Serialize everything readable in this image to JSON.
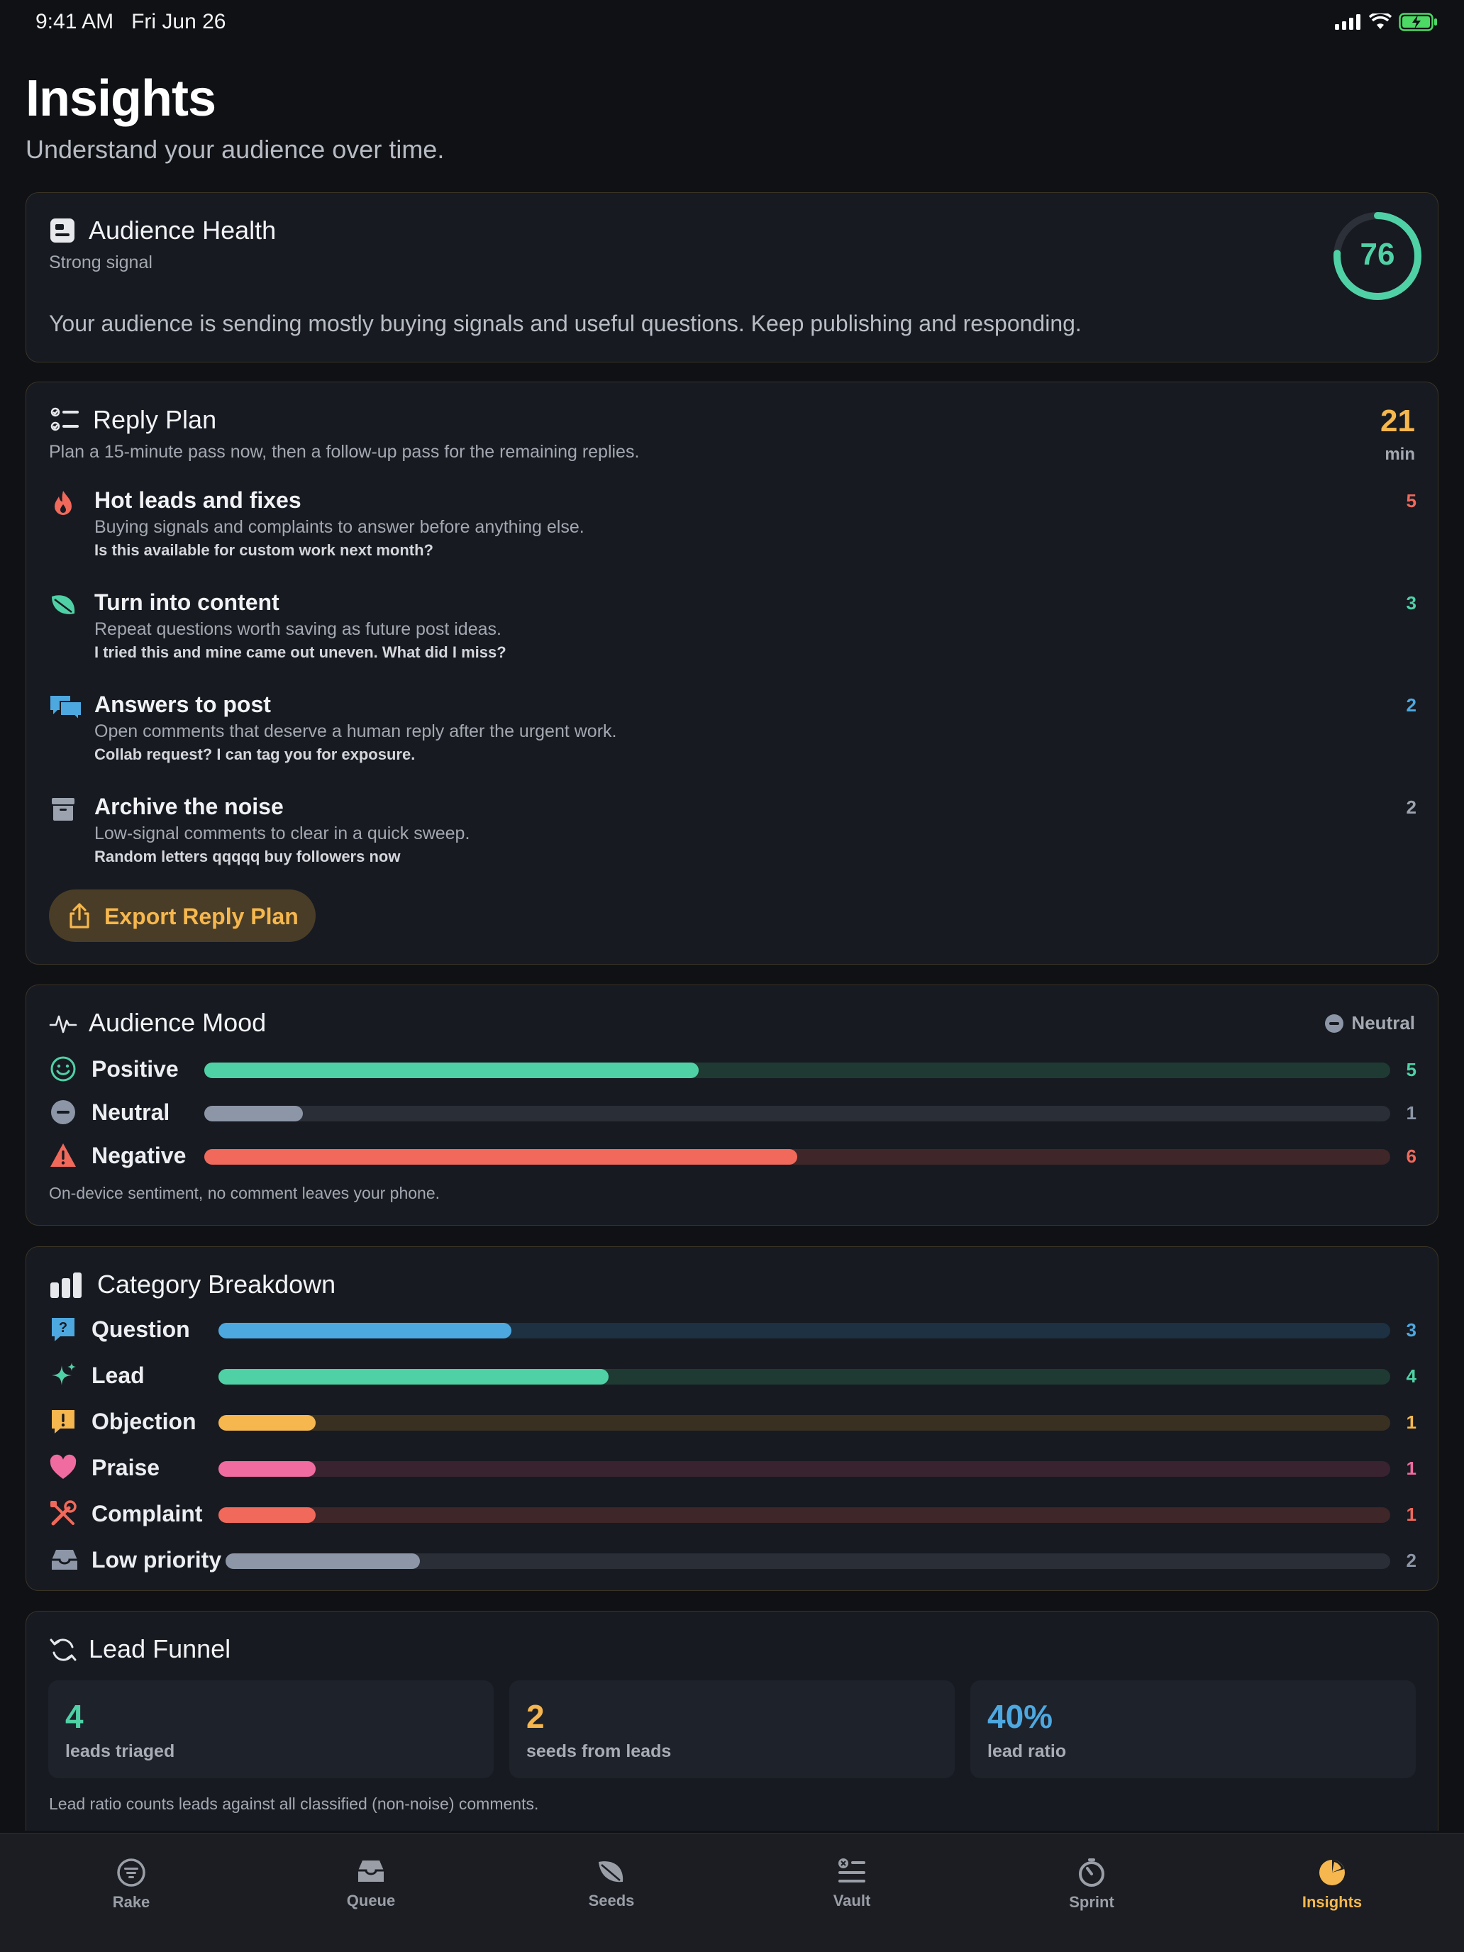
{
  "status_bar": {
    "time": "9:41 AM",
    "date": "Fri Jun 26",
    "icons": [
      "signal-icon",
      "wifi-icon",
      "battery-charging-icon"
    ]
  },
  "page": {
    "title": "Insights",
    "subtitle": "Understand your audience over time."
  },
  "audience_health": {
    "title": "Audience Health",
    "status": "Strong signal",
    "score": "76",
    "score_fraction": 0.76,
    "description": "Your audience is sending mostly buying signals and useful questions. Keep publishing and responding.",
    "icon": "id-card-icon"
  },
  "reply_plan": {
    "title": "Reply Plan",
    "description": "Plan a 15-minute pass now, then a follow-up pass for the remaining replies.",
    "minutes": "21",
    "minutes_unit": "min",
    "items": [
      {
        "title": "Hot leads and fixes",
        "desc": "Buying signals and complaints to answer before anything else.",
        "example": "Is this available for custom work next month?",
        "count": "5",
        "color": "#f0695b",
        "icon": "flame-icon"
      },
      {
        "title": "Turn into content",
        "desc": "Repeat questions worth saving as future post ideas.",
        "example": "I tried this and mine came out uneven. What did I miss?",
        "count": "3",
        "color": "#4fd1a5",
        "icon": "leaf-icon"
      },
      {
        "title": "Answers to post",
        "desc": "Open comments that deserve a human reply after the urgent work.",
        "example": "Collab request? I can tag you for exposure.",
        "count": "2",
        "color": "#4ea8e0",
        "icon": "chat-bubbles-icon"
      },
      {
        "title": "Archive the noise",
        "desc": "Low-signal comments to clear in a quick sweep.",
        "example": "Random letters qqqqq buy followers now",
        "count": "2",
        "color": "#9ca3af",
        "icon": "archive-box-icon"
      }
    ],
    "export_label": "Export Reply Plan"
  },
  "audience_mood": {
    "title": "Audience Mood",
    "overall": "Neutral",
    "footnote": "On-device sentiment, no comment leaves your phone.",
    "rows": [
      {
        "label": "Positive",
        "count": "5",
        "fraction": 0.417,
        "color": "#4fd1a5",
        "track": "#1f3a33",
        "icon": "smile-icon"
      },
      {
        "label": "Neutral",
        "count": "1",
        "fraction": 0.083,
        "color": "#8c96a6",
        "track": "#2a2e37",
        "icon": "minus-circle-icon"
      },
      {
        "label": "Negative",
        "count": "6",
        "fraction": 0.5,
        "color": "#f0695b",
        "track": "#3e2629",
        "icon": "warning-triangle-icon"
      }
    ]
  },
  "category_breakdown": {
    "title": "Category Breakdown",
    "rows": [
      {
        "label": "Question",
        "count": "3",
        "fraction": 0.25,
        "color": "#4ea8e0",
        "track": "#1d3142",
        "icon": "question-bubble-icon"
      },
      {
        "label": "Lead",
        "count": "4",
        "fraction": 0.333,
        "color": "#4fd1a5",
        "track": "#1f3a33",
        "icon": "sparkle-icon"
      },
      {
        "label": "Objection",
        "count": "1",
        "fraction": 0.083,
        "color": "#f5b74e",
        "track": "#3a3022",
        "icon": "exclamation-bubble-icon"
      },
      {
        "label": "Praise",
        "count": "1",
        "fraction": 0.083,
        "color": "#f06ba0",
        "track": "#3a2331",
        "icon": "heart-icon"
      },
      {
        "label": "Complaint",
        "count": "1",
        "fraction": 0.083,
        "color": "#f0695b",
        "track": "#3e2629",
        "icon": "tools-icon"
      },
      {
        "label": "Low priority",
        "count": "2",
        "fraction": 0.167,
        "color": "#8c96a6",
        "track": "#2a2e37",
        "icon": "inbox-tray-icon"
      }
    ]
  },
  "lead_funnel": {
    "title": "Lead Funnel",
    "stats": [
      {
        "value": "4",
        "label": "leads triaged",
        "color": "#4fd1a5"
      },
      {
        "value": "2",
        "label": "seeds from leads",
        "color": "#f5b74e"
      },
      {
        "value": "40%",
        "label": "lead ratio",
        "color": "#4ea8e0"
      }
    ],
    "footnote": "Lead ratio counts leads against all classified (non-noise) comments."
  },
  "tab_bar": {
    "active": "Insights",
    "active_color": "#f5b74e",
    "tabs": [
      {
        "label": "Rake",
        "icon": "rake-list-icon"
      },
      {
        "label": "Queue",
        "icon": "tray-icon"
      },
      {
        "label": "Seeds",
        "icon": "leaf-icon"
      },
      {
        "label": "Vault",
        "icon": "vault-list-icon"
      },
      {
        "label": "Sprint",
        "icon": "timer-icon"
      },
      {
        "label": "Insights",
        "icon": "pie-chart-icon"
      }
    ]
  }
}
